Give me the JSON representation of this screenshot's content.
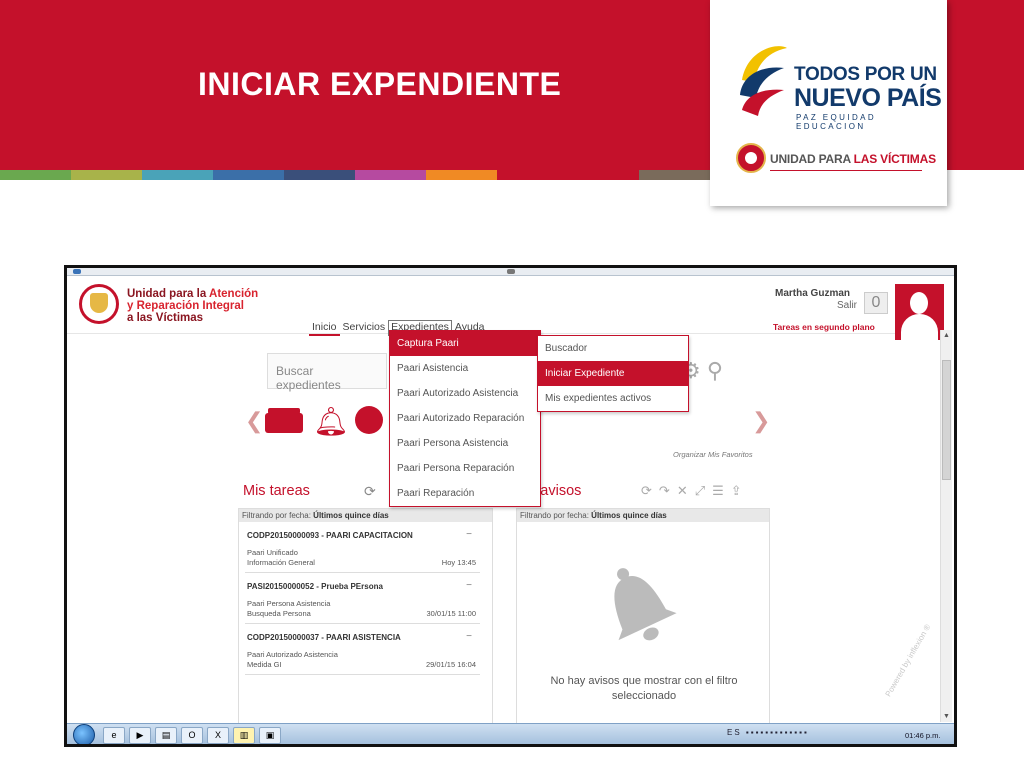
{
  "slide": {
    "title": "INICIAR EXPENDIENTE",
    "stripe_colors": [
      "#6aa84f",
      "#a8b34a",
      "#4aa3b8",
      "#3b6fa8",
      "#3a4f7a",
      "#b64aa0",
      "#f08a24",
      "#c4112b",
      "#c4112b",
      "#7a6b5b"
    ],
    "banner_color": "#c4112b"
  },
  "logo": {
    "line1": "TODOS POR UN",
    "line2": "NUEVO PAÍS",
    "line3": "PAZ  EQUIDAD  EDUCACION",
    "unit_prefix": "UNIDAD PARA ",
    "unit_suffix": "LAS VÍCTIMAS"
  },
  "app": {
    "logo_line1a": "Unidad para la ",
    "logo_line1b": "Atención",
    "logo_line2": "y Reparación Integral",
    "logo_line3": "a las Víctimas",
    "nav": [
      "Inicio",
      "Servicios",
      "Expedientes",
      "Ayuda"
    ],
    "user_name": "Martha Guzman",
    "logout": "Salir",
    "notification_count": "0",
    "background_tasks": "Tareas en segundo plano",
    "search_placeholder": "Buscar expedientes",
    "organize_favorites": "Organizar Mis Favoritos",
    "tasks_title": "Mis tareas",
    "notices_title": "s avisos",
    "filter_label": "Filtrando por fecha:",
    "filter_value": "Últimos quince días",
    "no_notices": "No hay avisos que mostrar con el filtro seleccionado",
    "watermark": "Powered by inflexion ®"
  },
  "tasks": [
    {
      "title": "CODP20150000093 - PAARI CAPACITACION",
      "line1": "Paari Unificado",
      "line2": "Información General",
      "time": "Hoy 13:45"
    },
    {
      "title": "PASI20150000052 - Prueba PErsona",
      "line1": "Paari Persona Asistencia",
      "line2": "Busqueda Persona",
      "time": "30/01/15 11:00"
    },
    {
      "title": "CODP20150000037 - PAARI ASISTENCIA",
      "line1": "Paari Autorizado Asistencia",
      "line2": "Medida GI",
      "time": "29/01/15 16:04"
    }
  ],
  "menu_expedientes": [
    "Captura Paari",
    "Paari Asistencia",
    "Paari Autorizado Asistencia",
    "Paari Autorizado Reparación",
    "Paari Persona Asistencia",
    "Paari Persona Reparación",
    "Paari Reparación"
  ],
  "submenu": [
    "Buscador",
    "Iniciar Expediente",
    "Mis expedientes activos"
  ],
  "taskbar": {
    "language": "ES",
    "clock": "01:46 p.m."
  }
}
